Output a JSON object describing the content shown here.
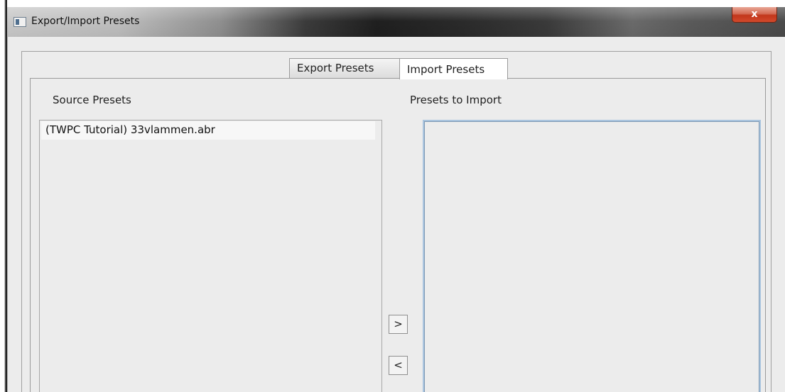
{
  "window": {
    "title": "Export/Import Presets",
    "close_label": "x"
  },
  "tabs": [
    {
      "label": "Export Presets",
      "selected": false
    },
    {
      "label": "Import Presets",
      "selected": true
    }
  ],
  "source": {
    "label": "Source Presets",
    "items": [
      {
        "label": "(TWPC Tutorial)  33vlammen.abr"
      }
    ]
  },
  "target": {
    "label": "Presets to Import",
    "items": []
  },
  "buttons": {
    "add_label": ">",
    "remove_label": "<"
  }
}
